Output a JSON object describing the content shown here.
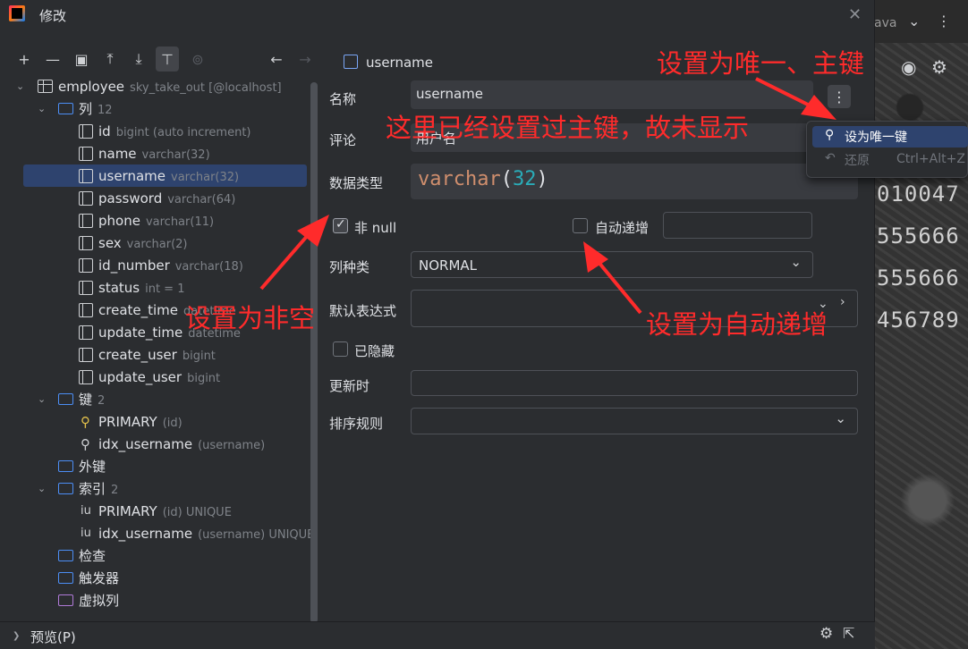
{
  "dialog": {
    "title": "修改",
    "close": "✕"
  },
  "toolbar": {
    "add": "+",
    "remove": "—",
    "columns": "▣",
    "up": "⤒",
    "down": "⤓",
    "pin": "⊤",
    "tag": "⊚",
    "back": "←",
    "fwd": "→"
  },
  "tree": {
    "table_name": "employee",
    "table_ctx": "sky_take_out [@localhost]",
    "columns_label": "列",
    "columns_count": "12",
    "columns": [
      {
        "name": "id",
        "type": "bigint (auto increment)"
      },
      {
        "name": "name",
        "type": "varchar(32)"
      },
      {
        "name": "username",
        "type": "varchar(32)"
      },
      {
        "name": "password",
        "type": "varchar(64)"
      },
      {
        "name": "phone",
        "type": "varchar(11)"
      },
      {
        "name": "sex",
        "type": "varchar(2)"
      },
      {
        "name": "id_number",
        "type": "varchar(18)"
      },
      {
        "name": "status",
        "type": "int = 1"
      },
      {
        "name": "create_time",
        "type": "datetime"
      },
      {
        "name": "update_time",
        "type": "datetime"
      },
      {
        "name": "create_user",
        "type": "bigint"
      },
      {
        "name": "update_user",
        "type": "bigint"
      }
    ],
    "keys_label": "键",
    "keys_count": "2",
    "keys": [
      {
        "name": "PRIMARY",
        "detail": "(id)"
      },
      {
        "name": "idx_username",
        "detail": "(username)"
      }
    ],
    "fk_label": "外键",
    "index_label": "索引",
    "index_count": "2",
    "indexes": [
      {
        "name": "PRIMARY",
        "detail": "(id) UNIQUE"
      },
      {
        "name": "idx_username",
        "detail": "(username) UNIQUE"
      }
    ],
    "check_label": "检查",
    "trigger_label": "触发器",
    "virtual_label": "虚拟列"
  },
  "form": {
    "header": "username",
    "name_label": "名称",
    "name_value": "username",
    "comment_label": "评论",
    "comment_value": "用户名",
    "type_label": "数据类型",
    "type_kw": "varchar",
    "type_open": "(",
    "type_num": "32",
    "type_close": ")",
    "notnull_label": "非 null",
    "autoinc_label": "自动递增",
    "kind_label": "列种类",
    "kind_value": "NORMAL",
    "default_label": "默认表达式",
    "hidden_label": "已隐藏",
    "update_label": "更新时",
    "collation_label": "排序规则",
    "more": "⋮"
  },
  "popup": {
    "item1": "设为唯一键",
    "item2": "还原",
    "item2_shortcut": "Ctrl+Alt+Z"
  },
  "background": {
    "nums": [
      "010047",
      "555666",
      "555666",
      "456789"
    ],
    "ava": "ava"
  },
  "annotations": {
    "a1": "设置为唯一、主键",
    "a2": "这里已经设置过主键，故未显示",
    "a3": "设置为非空",
    "a4": "设置为自动递增"
  },
  "bottom": {
    "preview": "预览(P)"
  },
  "colors": {
    "annotation": "#ff2b2b",
    "selection": "#2e436e",
    "keyword": "#cf8e6d",
    "number": "#2aacb8"
  }
}
